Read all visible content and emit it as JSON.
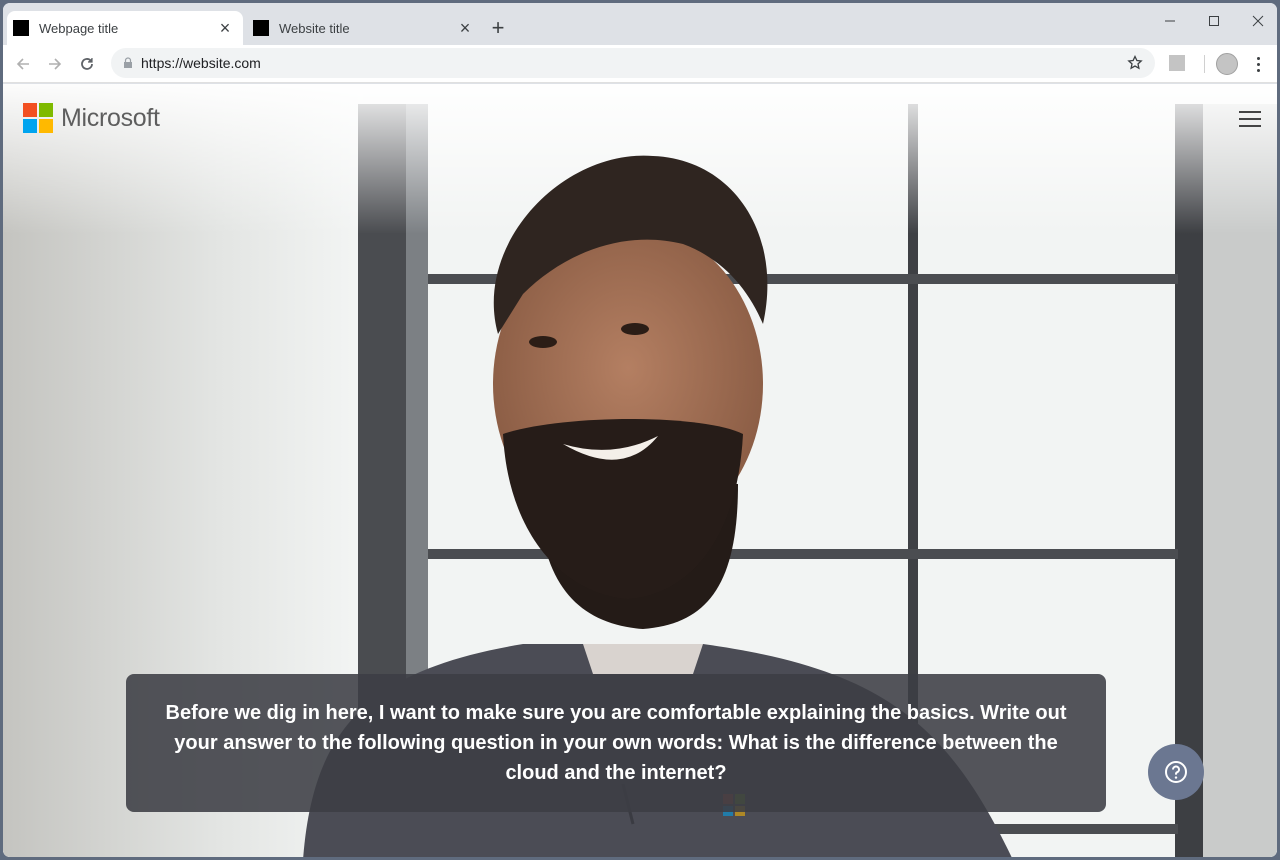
{
  "browser": {
    "tabs": [
      {
        "title": "Webpage title",
        "active": true
      },
      {
        "title": "Website title",
        "active": false
      }
    ],
    "url": "https://website.com"
  },
  "page": {
    "brand": "Microsoft",
    "caption": "Before we dig in here, I want to make sure you are comfortable explaining the basics. Write out your answer to the following question in your own words: What is the difference between the cloud and the internet?",
    "logo_colors": [
      "#f25022",
      "#7fba00",
      "#00a4ef",
      "#ffb900"
    ]
  }
}
